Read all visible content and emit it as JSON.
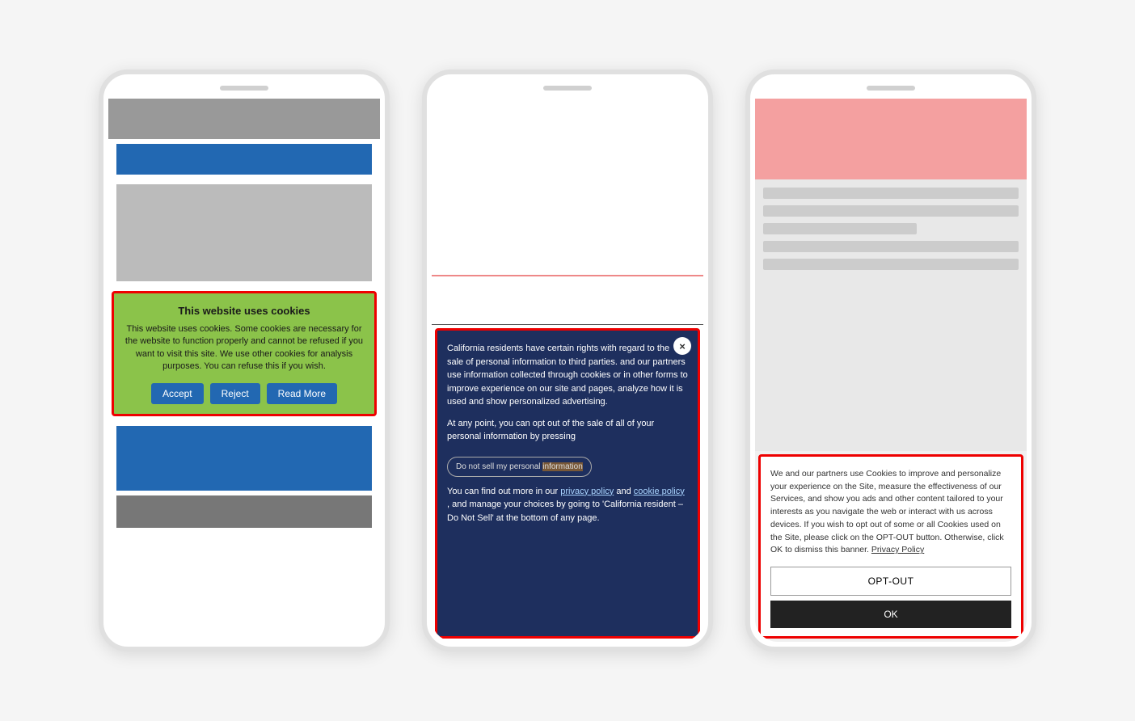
{
  "phone1": {
    "cookie": {
      "title": "This website uses cookies",
      "body": "This website uses cookies. Some cookies are necessary for the website to function properly and cannot be refused if you want to visit this site. We use other cookies for analysis purposes. You can refuse this if you wish.",
      "accept": "Accept",
      "reject": "Reject",
      "readMore": "Read More"
    }
  },
  "phone2": {
    "cookie": {
      "body1": "California residents have certain rights with regard to the sale of personal information to third parties.",
      "body2": "and our partners use information collected through cookies or in other forms to improve experience on our site and pages, analyze how it is used and show personalized advertising.",
      "body3": "At any point, you can opt out of the sale of all of your personal information by pressing",
      "dontSell": "Do not sell my personal information",
      "body4": "You can find out more in our",
      "privacy": "privacy policy",
      "and": "and",
      "cookie": "cookie policy",
      "body5": ", and manage your choices by going to 'California resident – Do Not Sell' at the bottom of any page.",
      "close": "×"
    }
  },
  "phone3": {
    "cookie": {
      "body": "We and our partners use Cookies to improve and personalize your experience on the Site, measure the effectiveness of our Services, and show you ads and other content tailored to your interests as you navigate the web or interact with us across devices. If you wish to opt out of some or all Cookies used on the Site, please click on the OPT-OUT button. Otherwise, click OK to dismiss this banner.",
      "privacyPolicy": "Privacy Policy",
      "optOut": "OPT-OUT",
      "ok": "OK"
    }
  }
}
